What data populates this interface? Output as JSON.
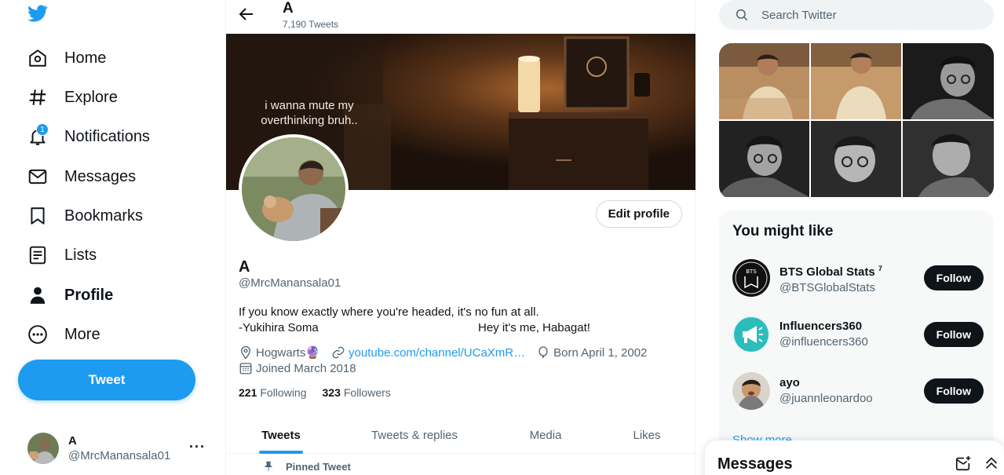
{
  "nav": {
    "items": [
      {
        "label": "Home",
        "icon": "home-icon"
      },
      {
        "label": "Explore",
        "icon": "hashtag-icon"
      },
      {
        "label": "Notifications",
        "icon": "bell-icon",
        "badge": "1"
      },
      {
        "label": "Messages",
        "icon": "envelope-icon"
      },
      {
        "label": "Bookmarks",
        "icon": "bookmark-icon"
      },
      {
        "label": "Lists",
        "icon": "list-icon"
      },
      {
        "label": "Profile",
        "icon": "person-icon",
        "active": true
      },
      {
        "label": "More",
        "icon": "more-circle-icon"
      }
    ],
    "tweet_button": "Tweet",
    "account": {
      "name": "A",
      "handle": "@MrcManansala01",
      "menu": "···"
    }
  },
  "header": {
    "name": "A",
    "tweet_count": "7,190 Tweets"
  },
  "banner": {
    "text_line1": "i wanna mute my",
    "text_line2": "overthinking bruh.."
  },
  "profile": {
    "edit_button": "Edit profile",
    "name": "A",
    "handle": "@MrcManansala01",
    "bio_line1": "If you know exactly where you're headed, it's no fun at all.",
    "bio_line2": "-Yukihira Soma",
    "bio_line3": "Hey it's me, Habagat!",
    "location": "Hogwarts🔮",
    "website": "youtube.com/channel/UCaXmR…",
    "birthday": "Born April 1, 2002",
    "joined": "Joined March 2018",
    "following_count": "221",
    "following_label": "Following",
    "followers_count": "323",
    "followers_label": "Followers"
  },
  "tabs": [
    {
      "label": "Tweets",
      "active": true
    },
    {
      "label": "Tweets & replies"
    },
    {
      "label": "Media"
    },
    {
      "label": "Likes"
    }
  ],
  "pinned_label": "Pinned Tweet",
  "right": {
    "search_placeholder": "Search Twitter",
    "wtf_title": "You might like",
    "suggestions": [
      {
        "name": "BTS Global Stats",
        "badge": "7",
        "handle": "@BTSGlobalStats",
        "button": "Follow"
      },
      {
        "name": "Influencers360",
        "handle": "@influencers360",
        "button": "Follow"
      },
      {
        "name": "ayo",
        "handle": "@juannleonardoo",
        "button": "Follow"
      }
    ],
    "show_more": "Show more",
    "messages_title": "Messages"
  },
  "colors": {
    "accent": "#1d9bf0",
    "text": "#0f1419",
    "secondary": "#536471"
  }
}
